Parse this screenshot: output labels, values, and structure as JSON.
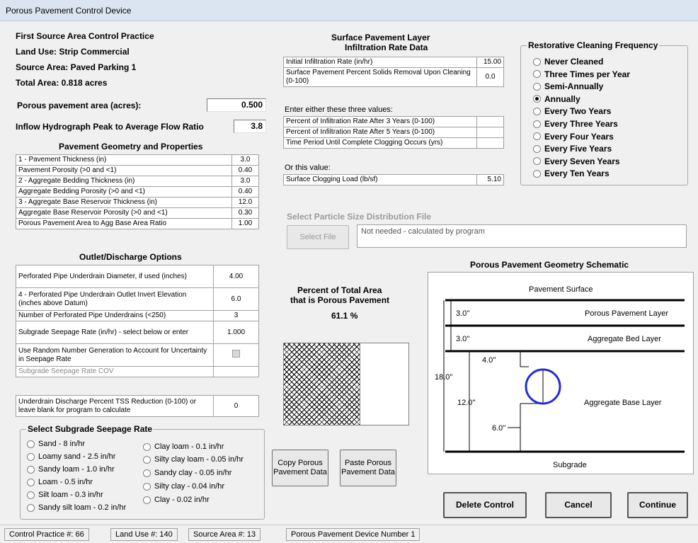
{
  "window": {
    "title": "Porous Pavement Control Device"
  },
  "info": {
    "practice": "First Source Area Control Practice",
    "land_use": "Land Use:  Strip Commercial",
    "source_area": "Source Area:  Paved Parking 1",
    "total_area": "Total Area:  0.818 acres"
  },
  "porous_area": {
    "label": "Porous pavement area (acres):",
    "value": "0.500"
  },
  "inflow_ratio": {
    "label": "Inflow Hydrograph Peak to Average Flow Ratio",
    "value": "3.8"
  },
  "geometry": {
    "title": "Pavement Geometry and Properties",
    "rows": [
      {
        "label": "1 - Pavement Thickness (in)",
        "value": "3.0"
      },
      {
        "label": "Pavement Porosity (>0 and <1)",
        "value": "0.40"
      },
      {
        "label": "2 - Aggregate Bedding Thickness (in)",
        "value": "3.0"
      },
      {
        "label": "Aggregate Bedding Porosity (>0 and <1)",
        "value": "0.40"
      },
      {
        "label": "3 - Aggregate Base Reservoir Thickness (in)",
        "value": "12.0"
      },
      {
        "label": "Aggregate Base Reservoir Porosity  (>0 and <1)",
        "value": "0.30"
      },
      {
        "label": "Porous Pavement Area to Agg Base Area Ratio",
        "value": "1.00"
      }
    ]
  },
  "outlet": {
    "title": "Outlet/Discharge Options",
    "rows": [
      {
        "label": "Perforated Pipe Underdrain Diameter, if used (inches)",
        "value": "4.00"
      },
      {
        "label": "4 - Perforated Pipe Underdrain Outlet Invert Elevation (inches above Datum)",
        "value": "6.0"
      },
      {
        "label": "Number of Perforated Pipe Underdrains (<250)",
        "value": "3"
      },
      {
        "label": "Subgrade Seepage Rate (in/hr) - select below or enter",
        "value": "1.000"
      },
      {
        "label": "Use Random Number Generation to Account for Uncertainty in Seepage Rate",
        "value": ""
      },
      {
        "label": "Subgrade Seepage Rate COV",
        "value": ""
      }
    ],
    "tss_label": "Underdrain Discharge Percent TSS Reduction (0-100) or leave blank for program to calculate",
    "tss_value": "0"
  },
  "seepage": {
    "title": "Select Subgrade Seepage Rate",
    "left": [
      "Sand - 8 in/hr",
      "Loamy sand - 2.5 in/hr",
      "Sandy loam - 1.0 in/hr",
      "Loam - 0.5 in/hr",
      "Silt loam - 0.3 in/hr",
      "Sandy silt loam - 0.2 in/hr"
    ],
    "right": [
      "Clay loam - 0.1 in/hr",
      "Silty clay loam - 0.05 in/hr",
      "Sandy clay - 0.05 in/hr",
      "Silty clay - 0.04 in/hr",
      "Clay - 0.02 in/hr"
    ]
  },
  "surface": {
    "title1": "Surface Pavement Layer",
    "title2": "Infiltration Rate Data",
    "rows_a": [
      {
        "label": "Initial Infiltration Rate (in/hr)",
        "value": "15.00"
      },
      {
        "label": "Surface Pavement Percent Solids Removal Upon Cleaning (0-100)",
        "value": "0.0"
      }
    ],
    "either_label": "Enter either these three values:",
    "rows_b": [
      {
        "label": "Percent of Infiltration Rate After 3 Years (0-100)",
        "value": ""
      },
      {
        "label": "Percent of Infiltration Rate After 5 Years (0-100)",
        "value": ""
      },
      {
        "label": "Time Period Until Complete Clogging Occurs (yrs)",
        "value": ""
      }
    ],
    "or_label": "Or this value:",
    "rows_c": [
      {
        "label": "Surface Clogging Load (lb/sf)",
        "value": "5.10"
      }
    ]
  },
  "cleaning": {
    "title": "Restorative Cleaning Frequency",
    "options": [
      "Never Cleaned",
      "Three Times per Year",
      "Semi-Annually",
      "Annually",
      "Every Two Years",
      "Every Three Years",
      "Every Four Years",
      "Every Five Years",
      "Every Seven Years",
      "Every Ten Years"
    ],
    "selected_index": 3
  },
  "particle": {
    "title": "Select Particle Size Distribution File",
    "button": "Select File",
    "file_text": "Not needed - calculated by program"
  },
  "percent": {
    "title1": "Percent of Total Area",
    "title2": "that is Porous Pavement",
    "value": "61.1 %",
    "fraction": 0.611
  },
  "buttons": {
    "copy": "Copy Porous Pavement Data",
    "paste": "Paste Porous Pavement Data",
    "delete": "Delete Control",
    "cancel": "Cancel",
    "continue": "Continue"
  },
  "schematic": {
    "title": "Porous Pavement Geometry  Schematic",
    "surface": "Pavement Surface",
    "porous_layer": "Porous Pavement Layer",
    "bed_layer": "Aggregate Bed Layer",
    "base_layer": "Aggregate Base Layer",
    "subgrade": "Subgrade",
    "d1": "3.0''",
    "d2": "3.0''",
    "d3": "4.0''",
    "d4": "18.0''",
    "d5": "12.0''",
    "d6": "6.0''",
    "pipe_color": "#1f2fd6"
  },
  "status": {
    "practice": "Control Practice #:  66",
    "land_use": "Land Use #:  140",
    "source_area": "Source Area #:  13",
    "device": "Porous Pavement Device Number 1"
  }
}
